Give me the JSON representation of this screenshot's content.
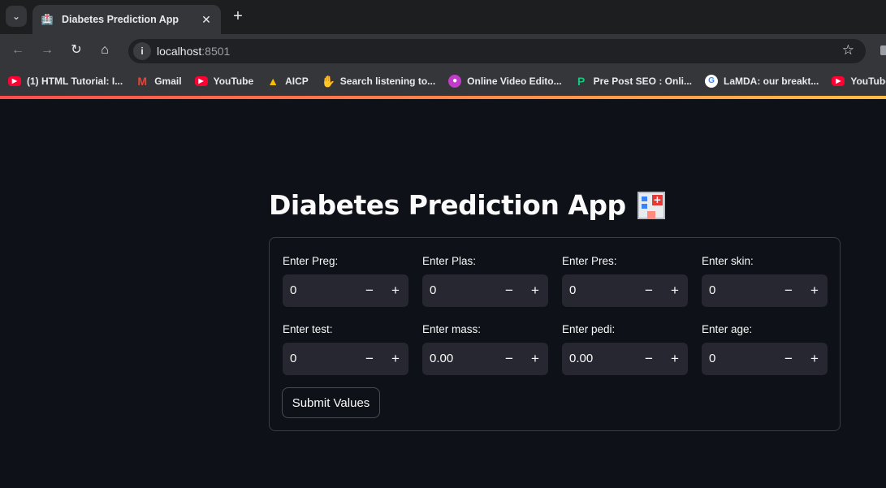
{
  "browser": {
    "tab_title": "Diabetes Prediction App",
    "url_host": "localhost",
    "url_port": ":8501"
  },
  "bookmarks": [
    {
      "label": "(1) HTML Tutorial: I...",
      "icon": "youtube-icon"
    },
    {
      "label": "Gmail",
      "icon": "gmail-icon"
    },
    {
      "label": "YouTube",
      "icon": "youtube-icon"
    },
    {
      "label": "AICP",
      "icon": "drive-icon"
    },
    {
      "label": "Search listening to...",
      "icon": "hand-icon"
    },
    {
      "label": "Online Video Edito...",
      "icon": "video-editor-icon"
    },
    {
      "label": "Pre Post SEO : Onli...",
      "icon": "prepostseo-icon"
    },
    {
      "label": "LaMDA: our breakt...",
      "icon": "google-icon"
    },
    {
      "label": "YouTube Creator",
      "icon": "youtube-icon"
    }
  ],
  "app": {
    "title": "Diabetes Prediction App",
    "fields": [
      {
        "label": "Enter Preg:",
        "value": "0"
      },
      {
        "label": "Enter Plas:",
        "value": "0"
      },
      {
        "label": "Enter Pres:",
        "value": "0"
      },
      {
        "label": "Enter skin:",
        "value": "0"
      },
      {
        "label": "Enter test:",
        "value": "0"
      },
      {
        "label": "Enter mass:",
        "value": "0.00"
      },
      {
        "label": "Enter pedi:",
        "value": "0.00"
      },
      {
        "label": "Enter age:",
        "value": "0"
      }
    ],
    "minus_symbol": "−",
    "plus_symbol": "+",
    "submit_label": "Submit Values"
  }
}
